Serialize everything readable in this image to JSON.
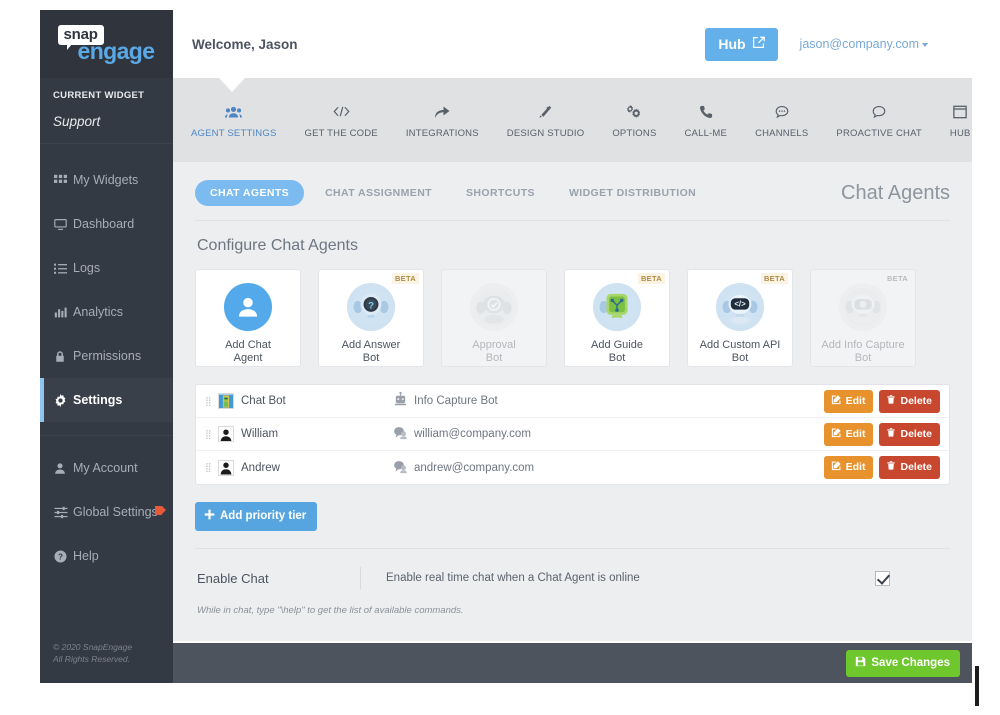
{
  "sidebar": {
    "logo": {
      "snap": "snap",
      "engage": "engage"
    },
    "widget_section_label": "CURRENT WIDGET",
    "widget_name": "Support",
    "items": [
      {
        "label": "My Widgets",
        "icon": "grid-icon",
        "active": false
      },
      {
        "label": "Dashboard",
        "icon": "monitor-icon",
        "active": false
      },
      {
        "label": "Logs",
        "icon": "list-icon",
        "active": false
      },
      {
        "label": "Analytics",
        "icon": "bar-chart-icon",
        "active": false
      },
      {
        "label": "Permissions",
        "icon": "lock-icon",
        "active": false
      },
      {
        "label": "Settings",
        "icon": "gear-icon",
        "active": true
      }
    ],
    "secondary_items": [
      {
        "label": "My Account",
        "icon": "user-icon",
        "badge": false
      },
      {
        "label": "Global Settings",
        "icon": "sliders-icon",
        "badge": true
      },
      {
        "label": "Help",
        "icon": "question-circle-icon",
        "badge": false
      }
    ],
    "copyright_line1": "© 2020 SnapEngage",
    "copyright_line2": "All Rights Reserved."
  },
  "topbar": {
    "welcome": "Welcome, Jason",
    "hub_label": "Hub",
    "hub_icon": "external-link-icon",
    "user_email": "jason@company.com"
  },
  "tabs": [
    {
      "label": "AGENT SETTINGS",
      "icon": "people-icon",
      "active": true
    },
    {
      "label": "GET THE CODE",
      "icon": "code-icon",
      "active": false
    },
    {
      "label": "INTEGRATIONS",
      "icon": "arrow-share-icon",
      "active": false
    },
    {
      "label": "DESIGN STUDIO",
      "icon": "magic-wand-icon",
      "active": false
    },
    {
      "label": "OPTIONS",
      "icon": "gears-icon",
      "active": false
    },
    {
      "label": "CALL-ME",
      "icon": "phone-icon",
      "active": false
    },
    {
      "label": "CHANNELS",
      "icon": "chat-dots-icon",
      "active": false
    },
    {
      "label": "PROACTIVE CHAT",
      "icon": "chat-bubble-icon",
      "active": false
    },
    {
      "label": "HUB",
      "icon": "window-icon",
      "active": false
    }
  ],
  "subtabs": [
    {
      "label": "CHAT AGENTS",
      "active": true
    },
    {
      "label": "CHAT ASSIGNMENT",
      "active": false
    },
    {
      "label": "SHORTCUTS",
      "active": false
    },
    {
      "label": "WIDGET DISTRIBUTION",
      "active": false
    }
  ],
  "page_title": "Chat Agents",
  "section_title": "Configure Chat Agents",
  "bot_cards": [
    {
      "label": "Add Chat\nAgent",
      "beta": "",
      "disabled": false,
      "icon": "person-avatar-icon"
    },
    {
      "label": "Add Answer\nBot",
      "beta": "BETA",
      "disabled": false,
      "icon": "answer-bot-icon"
    },
    {
      "label": "Approval\nBot",
      "beta": "",
      "disabled": true,
      "icon": "approval-bot-icon"
    },
    {
      "label": "Add Guide\nBot",
      "beta": "BETA",
      "disabled": false,
      "icon": "guide-bot-icon"
    },
    {
      "label": "Add Custom API\nBot",
      "beta": "BETA",
      "disabled": false,
      "icon": "custom-api-bot-icon"
    },
    {
      "label": "Add Info Capture\nBot",
      "beta": "BETA",
      "disabled": true,
      "icon": "info-capture-bot-icon"
    }
  ],
  "agents": [
    {
      "name": "Chat Bot",
      "meta": "Info Capture Bot",
      "avatar": "robot-avatar",
      "meta_icon": "bot-icon",
      "edit": "Edit",
      "delete": "Delete"
    },
    {
      "name": "William",
      "meta": "william@company.com",
      "avatar": "person-avatar",
      "meta_icon": "chat-agent-icon",
      "edit": "Edit",
      "delete": "Delete"
    },
    {
      "name": "Andrew",
      "meta": "andrew@company.com",
      "avatar": "person-avatar",
      "meta_icon": "chat-agent-icon",
      "edit": "Edit",
      "delete": "Delete"
    }
  ],
  "add_tier_label": "Add priority tier",
  "enable_chat": {
    "label": "Enable Chat",
    "description": "Enable real time chat when a Chat Agent is online",
    "checked": true
  },
  "hint": "While in chat, type \"\\help\" to get the list of available commands.",
  "footer": {
    "save_label": "Save Changes",
    "save_icon": "floppy-disk-icon"
  },
  "colors": {
    "sidebar_bg": "#343a44",
    "accent_blue": "#64b0ea",
    "tab_active": "#4e86c5",
    "edit_orange": "#e8922e",
    "delete_red": "#c8472f",
    "save_green": "#6fc72e",
    "content_bg": "#eceef0",
    "footer_bg": "#4e545e"
  }
}
